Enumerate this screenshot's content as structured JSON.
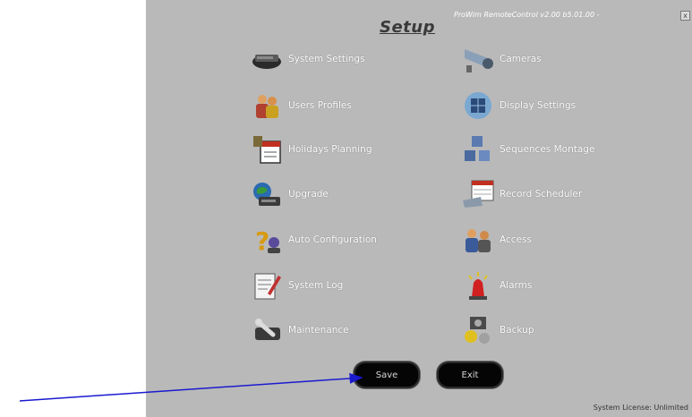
{
  "header": {
    "title": "Setup",
    "version": "ProWim RemoteControl v2.00 b5.01.00 -",
    "close_symbol": "x"
  },
  "menu": {
    "left": [
      {
        "label": "System Settings",
        "icon": "computer-icon"
      },
      {
        "label": "Users Profiles",
        "icon": "users-icon"
      },
      {
        "label": "Holidays Planning",
        "icon": "calendar-icon"
      },
      {
        "label": "Upgrade",
        "icon": "upgrade-icon"
      },
      {
        "label": "Auto Configuration",
        "icon": "help-icon"
      },
      {
        "label": "System Log",
        "icon": "log-icon"
      },
      {
        "label": "Maintenance",
        "icon": "tools-icon"
      }
    ],
    "right": [
      {
        "label": "Cameras",
        "icon": "camera-icon"
      },
      {
        "label": "Display Settings",
        "icon": "display-icon"
      },
      {
        "label": "Sequences Montage",
        "icon": "blocks-icon"
      },
      {
        "label": "Record Scheduler",
        "icon": "scheduler-icon"
      },
      {
        "label": "Access",
        "icon": "access-icon"
      },
      {
        "label": "Alarms",
        "icon": "alarm-icon"
      },
      {
        "label": "Backup",
        "icon": "backup-icon"
      }
    ]
  },
  "buttons": {
    "save": "Save",
    "exit": "Exit"
  },
  "status": {
    "license": "System License: Unlimited"
  },
  "colors": {
    "panel": "#b9b9b9",
    "button": "#050505",
    "arrow": "#1a1ad0"
  }
}
